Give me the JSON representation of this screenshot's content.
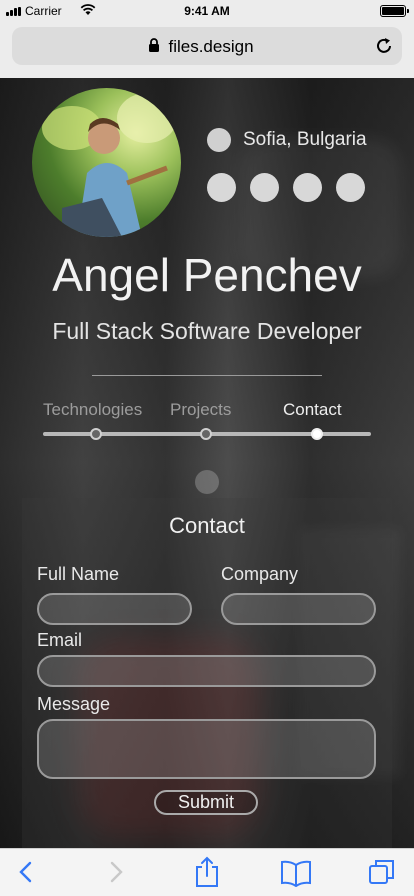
{
  "status_bar": {
    "carrier": "Carrier",
    "time": "9:41 AM"
  },
  "browser": {
    "url": "files.design"
  },
  "profile": {
    "name": "Angel Penchev",
    "title": "Full Stack Software Developer",
    "location": "Sofia, Bulgaria"
  },
  "tabs": [
    {
      "label": "Technologies"
    },
    {
      "label": "Projects"
    },
    {
      "label": "Contact"
    }
  ],
  "contact": {
    "title": "Contact",
    "full_name_label": "Full Name",
    "company_label": "Company",
    "email_label": "Email",
    "message_label": "Message",
    "submit_label": "Submit"
  },
  "colors": {
    "accent": "#ffffff",
    "toolbar_icon": "#3478f6"
  },
  "icons": [
    "lock-icon",
    "reload-icon",
    "back-icon",
    "forward-icon",
    "share-icon",
    "bookmarks-icon",
    "tabs-icon"
  ]
}
